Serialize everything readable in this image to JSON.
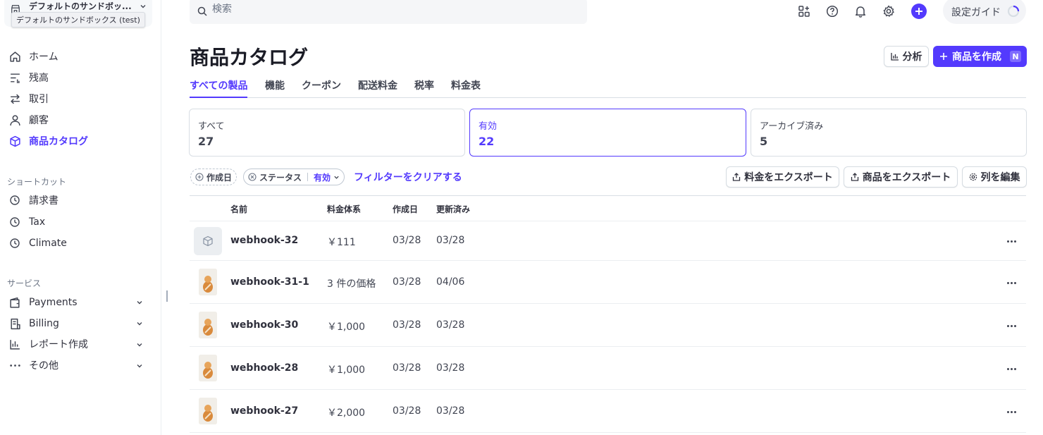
{
  "account": {
    "name": "デフォルトのサンドボッ...",
    "tooltip": "デフォルトのサンドボックス (test)"
  },
  "sidebar": {
    "main_items": [
      {
        "label": "ホーム",
        "icon": "home-icon"
      },
      {
        "label": "残高",
        "icon": "balance-icon"
      },
      {
        "label": "取引",
        "icon": "transactions-icon"
      },
      {
        "label": "顧客",
        "icon": "customer-icon"
      },
      {
        "label": "商品カタログ",
        "icon": "product-box-icon",
        "active": true
      }
    ],
    "shortcuts_title": "ショートカット",
    "shortcuts": [
      {
        "label": "請求書",
        "icon": "clock-icon"
      },
      {
        "label": "Tax",
        "icon": "clock-icon"
      },
      {
        "label": "Climate",
        "icon": "clock-icon"
      }
    ],
    "services_title": "サービス",
    "services": [
      {
        "label": "Payments",
        "icon": "wallet-icon"
      },
      {
        "label": "Billing",
        "icon": "billing-icon"
      },
      {
        "label": "レポート作成",
        "icon": "bar-chart-icon"
      },
      {
        "label": "その他",
        "icon": "more-icon"
      }
    ]
  },
  "search": {
    "placeholder": "検索"
  },
  "topbar": {
    "guide_label": "設定ガイド"
  },
  "page": {
    "title": "商品カタログ",
    "analyze_label": "分析",
    "create_label": "商品を作成",
    "create_shortcut": "N"
  },
  "tabs": [
    "すべての製品",
    "機能",
    "クーポン",
    "配送料金",
    "税率",
    "料金表"
  ],
  "status_cards": [
    {
      "label": "すべて",
      "count": "27"
    },
    {
      "label": "有効",
      "count": "22",
      "selected": true
    },
    {
      "label": "アーカイブ済み",
      "count": "5"
    }
  ],
  "filters": {
    "created_label": "作成日",
    "status_label": "ステータス",
    "status_value": "有効",
    "clear_label": "フィルターをクリアする",
    "export_prices_label": "料金をエクスポート",
    "export_products_label": "商品をエクスポート",
    "edit_columns_label": "列を編集"
  },
  "table": {
    "headers": [
      "名前",
      "料金体系",
      "作成日",
      "更新済み"
    ],
    "rows": [
      {
        "name": "webhook-32",
        "pricing": "￥111",
        "created": "03/28",
        "updated": "03/28",
        "image": "placeholder-box"
      },
      {
        "name": "webhook-31-1",
        "pricing": "3 件の価格",
        "created": "03/28",
        "updated": "04/06",
        "image": "product-photo"
      },
      {
        "name": "webhook-30",
        "pricing": "￥1,000",
        "created": "03/28",
        "updated": "03/28",
        "image": "product-photo"
      },
      {
        "name": "webhook-28",
        "pricing": "￥1,000",
        "created": "03/28",
        "updated": "03/28",
        "image": "product-photo"
      },
      {
        "name": "webhook-27",
        "pricing": "￥2,000",
        "created": "03/28",
        "updated": "03/28",
        "image": "product-photo"
      }
    ]
  },
  "colors": {
    "accent": "#533afd",
    "text": "#30313d",
    "border": "#d8dee4"
  }
}
